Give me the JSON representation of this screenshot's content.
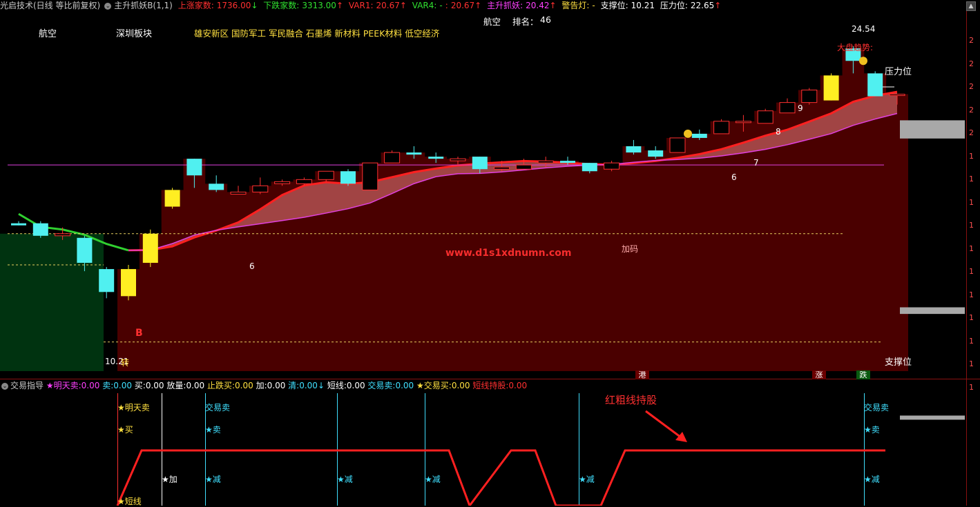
{
  "header": {
    "app_title": "光启技术(日线 等比前复权)",
    "indicator_name": "主升抓妖B(1,1)",
    "up_count_label": "上涨家数:",
    "up_count": "1736.00",
    "up_arrow": "↓",
    "down_count_label": "下跌家数:",
    "down_count": "3313.00",
    "down_arrow": "↑",
    "var1_label": "VAR1:",
    "var1": "20.67",
    "var1_arrow": "↑",
    "var4_label": "VAR4:",
    "var4": "-",
    "var4_sep": ":",
    "var4_val": "20.67",
    "var4_arrow": "↑",
    "zsyz_label": "主升抓妖:",
    "zsyz": "20.42",
    "zsyz_arrow": "↑",
    "warn_label": "警告灯:",
    "warn": "-",
    "support_label": "支撑位:",
    "support": "10.21",
    "pressure_label": "压力位:",
    "pressure": "22.65",
    "pressure_arrow": "↑"
  },
  "sectors": {
    "s1": "航空",
    "s2": "深圳板块",
    "s3": "雄安新区 国防军工 军民融合 石墨烯 新材料 PEEK材料 低空经济",
    "rank_sector": "航空",
    "rank_label": "排名：",
    "rank_value": "46"
  },
  "annotations": {
    "peak_price": "24.54",
    "low_price": "10.21",
    "trend_label": "大盘趋势:",
    "pressure_line": "压力位",
    "support_line": "支撑位",
    "add_label": "加码",
    "buy_marker": "B",
    "turn_label": "转",
    "counts": [
      "6",
      "6",
      "7",
      "8",
      "9"
    ],
    "tag_gang": "港",
    "tag_zhang": "涨",
    "tag_die": "跌",
    "watermark": "www.d1s1xdnumn.com",
    "axis_ticks": [
      "2",
      "2",
      "2",
      "2",
      "2",
      "1",
      "1",
      "1",
      "1",
      "1",
      "1",
      "1",
      "1",
      "1",
      "1",
      "1"
    ]
  },
  "lower": {
    "title": "交易指导",
    "f1_label": "★明天卖:",
    "f1": "0.00",
    "f2_label": "卖:",
    "f2": "0.00",
    "f3_label": "买:",
    "f3": "0.00",
    "f4_label": "放量:",
    "f4": "0.00",
    "f5_label": "止跌买:",
    "f5": "0.00",
    "f6_label": "加:",
    "f6": "0.00",
    "f7_label": "清:",
    "f7": "0.00",
    "f7_arrow": "↓",
    "f8_label": "短线:",
    "f8": "0.00",
    "f9_label": "交易卖:",
    "f9": "0.00",
    "f10_label": "★交易买:",
    "f10": "0.00",
    "f11_label": "短线持股:",
    "f11": "0.00",
    "hold_note": "红粗线持股",
    "m_mingtianmai": "★明天卖",
    "m_trade_sell_1": "交易卖",
    "m_trade_sell_2": "交易卖",
    "m_buy": "★买",
    "m_sell_1": "★卖",
    "m_sell_2": "★卖",
    "m_add": "★加",
    "m_reduce": "★减",
    "m_short": "★短线"
  },
  "colors": {
    "bg": "#000000",
    "up_candle": "#ff3030",
    "down_candle": "#50f0f0",
    "yellow_candle": "#ffee22",
    "band_fill": "#b05050",
    "area_fill": "#4a0000",
    "green_area": "#003310",
    "red_line": "#ff2020",
    "magenta_line": "#e040e0",
    "green_line": "#30d030"
  },
  "chart_data": {
    "type": "candlestick",
    "candles": [
      {
        "o": 16.0,
        "c": 16.1,
        "h": 16.2,
        "l": 16.0,
        "k": "c"
      },
      {
        "o": 16.1,
        "c": 15.5,
        "h": 16.2,
        "l": 15.4,
        "k": "c"
      },
      {
        "o": 15.5,
        "c": 15.6,
        "h": 15.9,
        "l": 15.3,
        "k": "u"
      },
      {
        "o": 15.4,
        "c": 14.2,
        "h": 15.5,
        "l": 13.8,
        "k": "c"
      },
      {
        "o": 13.9,
        "c": 12.8,
        "h": 14.0,
        "l": 12.5,
        "k": "c"
      },
      {
        "o": 12.6,
        "c": 13.9,
        "h": 14.1,
        "l": 12.4,
        "k": "y"
      },
      {
        "o": 14.2,
        "c": 15.6,
        "h": 15.8,
        "l": 14.0,
        "k": "y"
      },
      {
        "o": 16.9,
        "c": 17.7,
        "h": 17.8,
        "l": 16.8,
        "k": "y"
      },
      {
        "o": 19.2,
        "c": 18.4,
        "h": 19.2,
        "l": 17.8,
        "k": "c"
      },
      {
        "o": 18.0,
        "c": 17.7,
        "h": 18.4,
        "l": 17.6,
        "k": "c"
      },
      {
        "o": 17.5,
        "c": 17.6,
        "h": 17.9,
        "l": 17.5,
        "k": "u"
      },
      {
        "o": 17.6,
        "c": 17.9,
        "h": 18.3,
        "l": 17.5,
        "k": "u"
      },
      {
        "o": 18.0,
        "c": 18.1,
        "h": 18.2,
        "l": 17.9,
        "k": "u"
      },
      {
        "o": 18.0,
        "c": 18.2,
        "h": 18.3,
        "l": 17.9,
        "k": "u"
      },
      {
        "o": 18.2,
        "c": 18.6,
        "h": 18.6,
        "l": 18.1,
        "k": "u"
      },
      {
        "o": 18.6,
        "c": 18.0,
        "h": 18.7,
        "l": 17.9,
        "k": "c"
      },
      {
        "o": 17.7,
        "c": 19.0,
        "h": 19.0,
        "l": 17.7,
        "k": "u"
      },
      {
        "o": 19.0,
        "c": 19.5,
        "h": 19.6,
        "l": 19.0,
        "k": "u"
      },
      {
        "o": 19.5,
        "c": 19.4,
        "h": 19.8,
        "l": 19.2,
        "k": "c"
      },
      {
        "o": 19.3,
        "c": 19.2,
        "h": 19.5,
        "l": 19.0,
        "k": "c"
      },
      {
        "o": 19.1,
        "c": 19.2,
        "h": 19.3,
        "l": 18.9,
        "k": "u"
      },
      {
        "o": 19.3,
        "c": 18.7,
        "h": 19.3,
        "l": 18.5,
        "k": "c"
      },
      {
        "o": 18.7,
        "c": 18.8,
        "h": 19.1,
        "l": 18.6,
        "k": "u"
      },
      {
        "o": 18.7,
        "c": 18.9,
        "h": 19.2,
        "l": 18.7,
        "k": "u"
      },
      {
        "o": 19.0,
        "c": 19.1,
        "h": 19.3,
        "l": 18.8,
        "k": "u"
      },
      {
        "o": 19.1,
        "c": 19.0,
        "h": 19.3,
        "l": 18.9,
        "k": "c"
      },
      {
        "o": 19.0,
        "c": 18.6,
        "h": 19.0,
        "l": 18.5,
        "k": "c"
      },
      {
        "o": 18.7,
        "c": 19.0,
        "h": 19.1,
        "l": 18.6,
        "k": "u"
      },
      {
        "o": 19.5,
        "c": 19.8,
        "h": 20.1,
        "l": 19.4,
        "k": "c"
      },
      {
        "o": 19.6,
        "c": 19.3,
        "h": 19.8,
        "l": 19.2,
        "k": "c"
      },
      {
        "o": 19.5,
        "c": 20.2,
        "h": 20.2,
        "l": 19.5,
        "k": "u"
      },
      {
        "o": 20.2,
        "c": 20.4,
        "h": 20.6,
        "l": 20.1,
        "k": "c"
      },
      {
        "o": 20.4,
        "c": 21.0,
        "h": 21.1,
        "l": 20.4,
        "k": "u"
      },
      {
        "o": 21.0,
        "c": 21.0,
        "h": 21.3,
        "l": 20.5,
        "k": "u"
      },
      {
        "o": 20.9,
        "c": 21.5,
        "h": 21.6,
        "l": 20.9,
        "k": "u"
      },
      {
        "o": 21.4,
        "c": 21.9,
        "h": 22.1,
        "l": 21.4,
        "k": "u"
      },
      {
        "o": 21.9,
        "c": 22.5,
        "h": 22.6,
        "l": 21.8,
        "k": "u"
      },
      {
        "o": 22.0,
        "c": 23.2,
        "h": 23.3,
        "l": 22.0,
        "k": "y"
      },
      {
        "o": 23.9,
        "c": 24.5,
        "h": 24.6,
        "l": 23.3,
        "k": "c"
      },
      {
        "o": 23.3,
        "c": 22.2,
        "h": 23.4,
        "l": 22.2,
        "k": "c"
      },
      {
        "o": 22.3,
        "c": 22.3,
        "h": 22.3,
        "l": 21.8,
        "k": "u"
      }
    ],
    "volume_bars": [
      {
        "top": 0.18,
        "frac": 0.22
      },
      {
        "top": 0.56,
        "frac": 0.08
      },
      {
        "top": 0.78,
        "frac": 0.05
      }
    ],
    "hold_segments": [
      [
        0,
        0
      ],
      [
        1,
        1
      ],
      [
        2,
        1
      ],
      [
        3,
        1
      ],
      [
        4,
        1
      ],
      [
        5,
        0
      ],
      [
        6,
        1
      ],
      [
        7,
        0
      ],
      [
        8,
        0
      ],
      [
        9,
        1
      ],
      [
        10,
        1
      ],
      [
        11,
        1
      ],
      [
        12,
        1
      ],
      [
        13,
        1
      ]
    ]
  }
}
